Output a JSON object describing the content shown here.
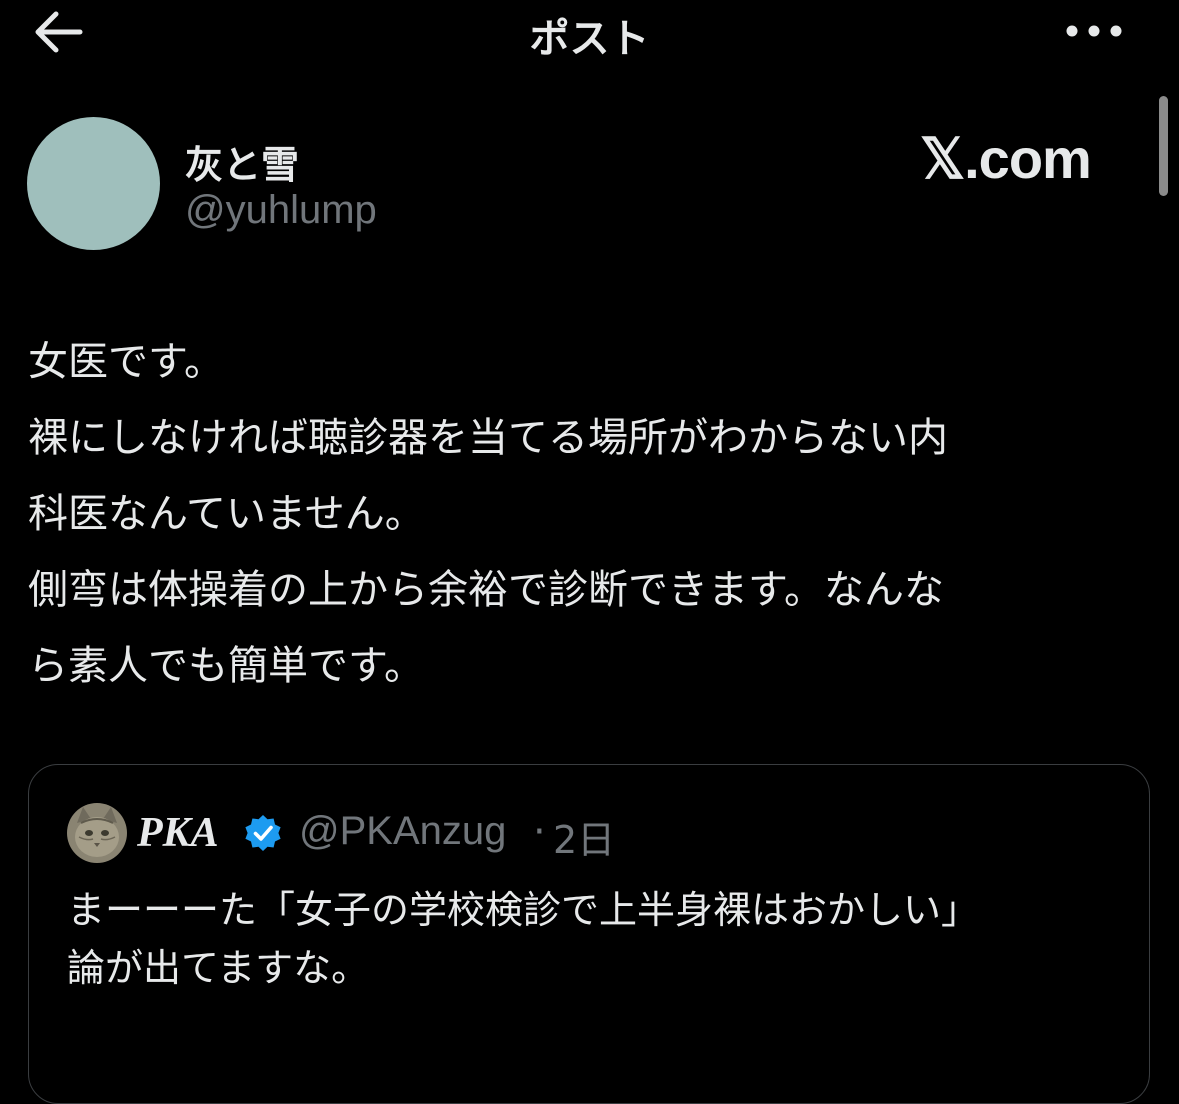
{
  "header": {
    "title": "ポスト",
    "back_icon": "arrow-left-icon",
    "more_icon": "more-horizontal-icon"
  },
  "author": {
    "display_name": "灰と雪",
    "handle": "@yuhlump",
    "avatar_color": "#9fbfbc"
  },
  "watermark": {
    "text": "𝕏.com"
  },
  "post": {
    "lines": [
      "女医です。",
      "裸にしなければ聴診器を当てる場所がわからない内",
      "科医なんていません。",
      "側弯は体操着の上から余裕で診断できます。なんな",
      "ら素人でも簡単です。"
    ]
  },
  "quote": {
    "display_name": "PKA",
    "verified_icon": "verified-badge-icon",
    "verified_color": "#1d9bf0",
    "handle": "@PKAnzug",
    "separator": "·",
    "time": "2日",
    "lines": [
      "まーーーた「女子の学校検診で上半身裸はおかしい」",
      "論が出てますな。"
    ]
  },
  "colors": {
    "background": "#000000",
    "text": "#e7e9ea",
    "muted": "#71767b",
    "border": "#3a3d40"
  }
}
